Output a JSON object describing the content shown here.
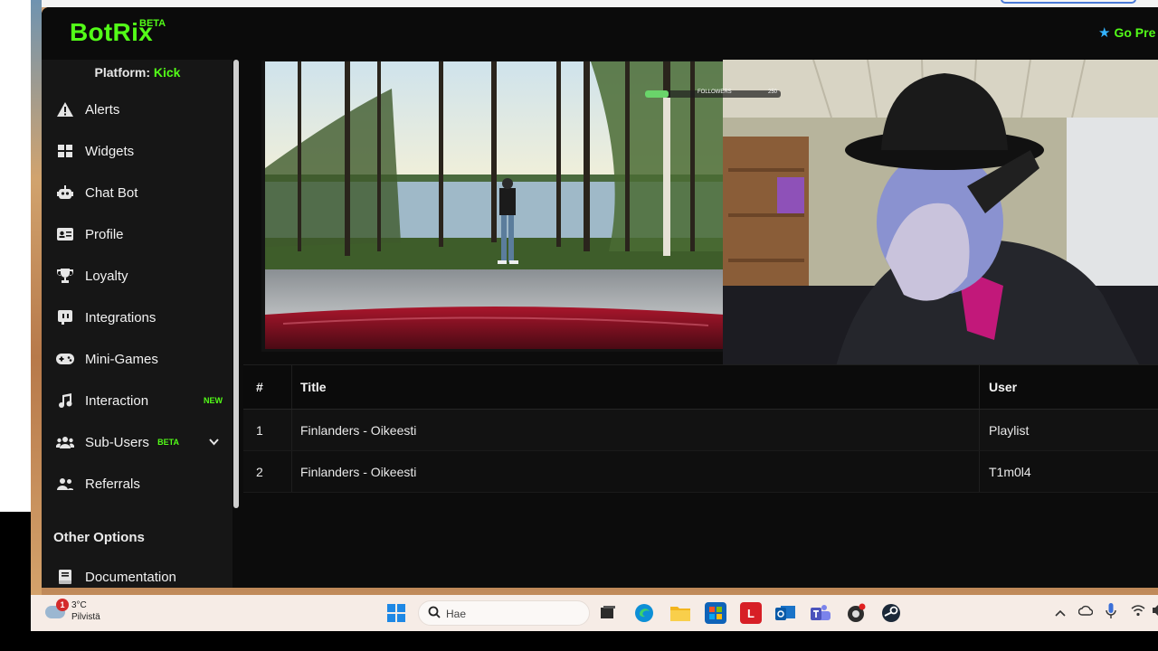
{
  "app": {
    "logo": "BotRix",
    "logo_badge": "BETA",
    "premium_label": "Go Pre"
  },
  "sidebar": {
    "platform_label": "Platform:",
    "platform_value": "Kick",
    "items": [
      {
        "label": "Alerts",
        "icon": "warning-icon"
      },
      {
        "label": "Widgets",
        "icon": "widgets-icon"
      },
      {
        "label": "Chat Bot",
        "icon": "robot-icon"
      },
      {
        "label": "Profile",
        "icon": "id-card-icon"
      },
      {
        "label": "Loyalty",
        "icon": "trophy-icon"
      },
      {
        "label": "Integrations",
        "icon": "integrations-icon"
      },
      {
        "label": "Mini-Games",
        "icon": "gamepad-icon"
      },
      {
        "label": "Interaction",
        "icon": "music-icon",
        "tag": "NEW"
      },
      {
        "label": "Sub-Users",
        "icon": "users-icon",
        "tag": "BETA"
      },
      {
        "label": "Referrals",
        "icon": "referrals-icon"
      }
    ],
    "section_title": "Other Options",
    "extra_items": [
      {
        "label": "Documentation",
        "icon": "book-icon"
      }
    ]
  },
  "stream": {
    "overlay_label": "FOLLOWERS",
    "overlay_count": "250"
  },
  "queue": {
    "headers": {
      "num": "#",
      "title": "Title",
      "user": "User"
    },
    "rows": [
      {
        "num": "1",
        "title": "Finlanders - Oikeesti",
        "user": "Playlist"
      },
      {
        "num": "2",
        "title": "Finlanders - Oikeesti",
        "user": "T1m0l4"
      }
    ]
  },
  "taskbar": {
    "weather_badge": "1",
    "weather_temp": "3°C",
    "weather_cond": "Pilvistä",
    "search_placeholder": "Hae"
  },
  "colors": {
    "accent": "#53fc18",
    "background": "#0c0c0c",
    "sidebar": "#161616"
  }
}
